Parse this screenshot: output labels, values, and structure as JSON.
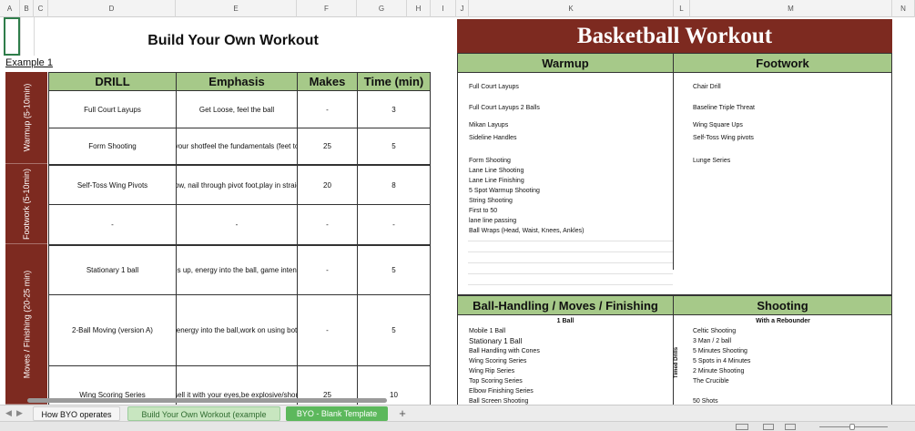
{
  "columns": [
    "A",
    "B",
    "C",
    "D",
    "E",
    "F",
    "G",
    "H",
    "I",
    "J",
    "K",
    "L",
    "M",
    "N"
  ],
  "left": {
    "title": "Build Your Own Workout",
    "example_link": "Example 1",
    "headers": [
      "DRILL",
      "Emphasis",
      "Makes",
      "Time (min)"
    ],
    "sections": [
      "Warmup (5-10min)",
      "Footwork (5-10min)",
      "Moves / Finishing (20-25 min)"
    ],
    "rows": [
      {
        "drill": "Full Court Layups",
        "emphasis": "Get Loose, feel the ball",
        "makes": "-",
        "time": "3"
      },
      {
        "drill": "Form Shooting",
        "emphasis": "your shotfeel the fundamentals (feet to",
        "makes": "25",
        "time": "5"
      },
      {
        "drill": "Self-Toss Wing Pivots",
        "emphasis": "low, nail through pivot foot,play in straig",
        "makes": "20",
        "time": "8"
      },
      {
        "drill": "-",
        "emphasis": "-",
        "makes": "-",
        "time": "-"
      },
      {
        "drill": "Stationary 1 ball",
        "emphasis": "es up, energy into the ball, game intens",
        "makes": "-",
        "time": "5"
      },
      {
        "drill": "2-Ball Moving (version A)",
        "emphasis": ", energy into the ball,work on using both",
        "makes": "-",
        "time": "5"
      },
      {
        "drill": "Wing Scoring Series",
        "emphasis": "sell it with your eyes,be explosive/shou",
        "makes": "25",
        "time": "10"
      }
    ]
  },
  "right": {
    "title": "Basketball Workout",
    "warmup_header": "Warmup",
    "footwork_header": "Footwork",
    "warmup_items": [
      "Full Court Layups",
      "Full Court Layups 2 Balls",
      "Mikan Layups",
      "Sideline Handles",
      "Form Shooting",
      "Lane Line Shooting",
      "Lane Line Finishing",
      "5 Spot Warmup Shooting",
      "String Shooting",
      "First to 50",
      "lane line passing",
      "Ball Wraps (Head, Waist, Knees, Ankles)"
    ],
    "footwork_items": [
      "Chair Drill",
      "Baseline Triple Threat",
      "Wing Square Ups",
      "Self-Toss Wing pivots",
      "Lunge Series"
    ],
    "ballhandling_header": "Ball-Handling / Moves / Finishing",
    "shooting_header": "Shooting",
    "ballhandling_sub": "1 Ball",
    "shooting_sub": "With a Rebounder",
    "timed_label": "Timed Drills",
    "ballhandling_items": [
      "Mobile 1 Ball",
      "Stationary 1 Ball",
      "Ball Handling with Cones",
      "Wing Scoring Series",
      "Wing Rip Series",
      "Top Scoring Series",
      "Elbow Finishing Series",
      "Ball Screen Shooting"
    ],
    "shooting_items": [
      "Celtic Shooting",
      "3 Man / 2 ball",
      "5 Minutes Shooting",
      "5 Spots in 4 Minutes",
      "2 Minute Shooting",
      "The Crucible",
      "",
      "50 Shots"
    ]
  },
  "tabs": {
    "tab1": "How BYO operates",
    "tab2": "Build Your Own Workout (example",
    "tab3": "BYO - Blank Template",
    "add": "+"
  },
  "colors": {
    "maroon": "#7d2a20",
    "green": "#a6c989",
    "tab_green": "#5cb85c"
  }
}
